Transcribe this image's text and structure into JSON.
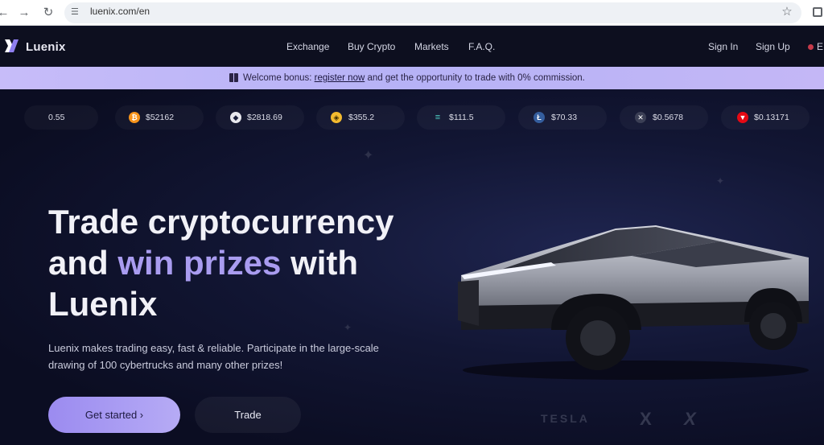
{
  "browser": {
    "url": "luenix.com/en"
  },
  "header": {
    "logo_text": "Luenix",
    "nav": [
      "Exchange",
      "Buy Crypto",
      "Markets",
      "F.A.Q."
    ],
    "sign_in": "Sign In",
    "sign_up": "Sign Up",
    "lang": "E"
  },
  "banner": {
    "prefix": "Welcome bonus: ",
    "link": "register now",
    "suffix": " and get the opportunity to trade with 0% commission."
  },
  "ticker": [
    {
      "price": "0.55",
      "icon": "partial-coin",
      "color": "#1a1e3b"
    },
    {
      "price": "$52162",
      "icon": "bitcoin-icon",
      "color": "#f7931a"
    },
    {
      "price": "$2818.69",
      "icon": "ethereum-icon",
      "color": "#e8e8ee"
    },
    {
      "price": "$355.2",
      "icon": "bnb-icon",
      "color": "#f3ba2f"
    },
    {
      "price": "$111.5",
      "icon": "solana-icon",
      "color": "#4fd1c5"
    },
    {
      "price": "$70.33",
      "icon": "litecoin-icon",
      "color": "#345d9d"
    },
    {
      "price": "$0.5678",
      "icon": "xrp-icon",
      "color": "#3b3f55"
    },
    {
      "price": "$0.13171",
      "icon": "tron-icon",
      "color": "#e50914"
    }
  ],
  "hero": {
    "title_line1": "Trade cryptocurrency",
    "title_line2_a": "and ",
    "title_line2_accent": "win prizes",
    "title_line2_b": " with",
    "title_line3": "Luenix",
    "description": "Luenix makes trading easy, fast & reliable. Participate in the large-scale drawing of 100 cybertrucks and many other prizes!",
    "cta_primary": "Get started ›",
    "cta_secondary": "Trade"
  },
  "partners": [
    "TESLA",
    "X",
    "X"
  ]
}
